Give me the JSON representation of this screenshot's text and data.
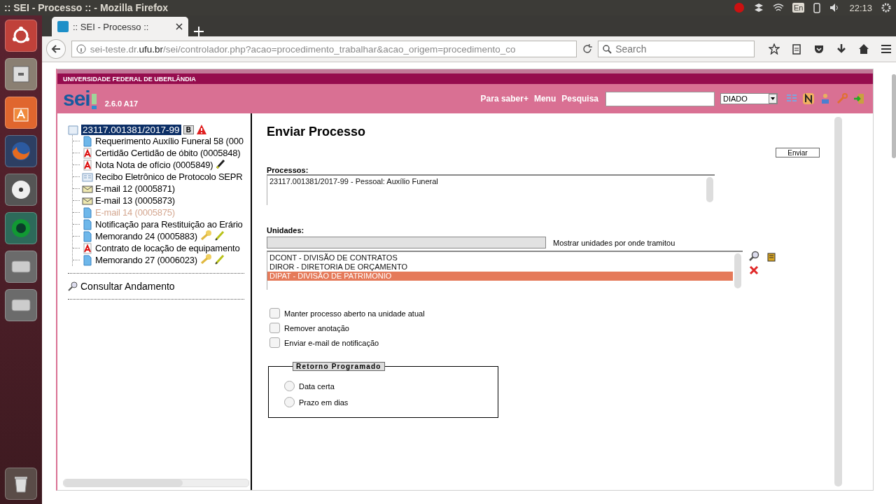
{
  "window": {
    "title": ":: SEI - Processo :: - Mozilla Firefox"
  },
  "system_tray": {
    "keyboard": "En",
    "time": "22:13"
  },
  "browser": {
    "tabs": [
      {
        "label": ":: SEI - Processo ::",
        "selected": true
      }
    ],
    "url": {
      "prefix": "sei-teste.dr.",
      "domain": "ufu.br",
      "path": "/sei/controlador.php?acao=procedimento_trabalhar&acao_origem=procedimento_co"
    },
    "search": {
      "placeholder": "Search"
    }
  },
  "sei": {
    "institution": "UNIVERSIDADE FEDERAL DE UBERLÂNDIA",
    "logo": "sei",
    "version": "2.6.0 A17",
    "links": [
      "Para saber+",
      "Menu",
      "Pesquisa"
    ],
    "unit_select": "DIADO"
  },
  "tree": {
    "label": "23117.001381/2017-99",
    "selected": true,
    "badge": "B",
    "children": [
      {
        "label": "Requerimento Auxílio Funeral 58 (000",
        "kind": "doc",
        "disabled": false,
        "key": false,
        "pen": false
      },
      {
        "label": "Certidão Certidão de óbito (0005848)",
        "kind": "pdf",
        "disabled": false,
        "key": false,
        "pen": false
      },
      {
        "label": "Nota Nota de ofício (0005849)",
        "kind": "pdf",
        "disabled": false,
        "key": false,
        "pen": true
      },
      {
        "label": "Recibo Eletrônico de Protocolo SEPR",
        "kind": "form",
        "disabled": false,
        "key": false,
        "pen": false
      },
      {
        "label": "E-mail 12 (0005871)",
        "kind": "email",
        "disabled": false,
        "key": false,
        "pen": false
      },
      {
        "label": "E-mail 13 (0005873)",
        "kind": "email",
        "disabled": false,
        "key": false,
        "pen": false
      },
      {
        "label": "E-mail 14 (0005875)",
        "kind": "doc",
        "disabled": true,
        "key": false,
        "pen": false
      },
      {
        "label": "Notificação para Restituição ao Erário",
        "kind": "doc",
        "disabled": false,
        "key": false,
        "pen": false
      },
      {
        "label": "Memorando 24 (0005883)",
        "kind": "doc",
        "disabled": false,
        "key": true,
        "pen": true
      },
      {
        "label": "Contrato de locação de equipamento",
        "kind": "pdf",
        "disabled": false,
        "key": false,
        "pen": false
      },
      {
        "label": "Memorando 27 (0006023)",
        "kind": "doc",
        "disabled": false,
        "key": true,
        "pen": true
      }
    ]
  },
  "side_links": [
    "Consultar Andamento"
  ],
  "form": {
    "title": "Enviar Processo",
    "submit": "Enviar",
    "processes_label": "Processos:",
    "processes": [
      "23117.001381/2017-99 - Pessoal: Auxílio Funeral"
    ],
    "units_label": "Unidades:",
    "show_units_label": "Mostrar unidades por onde tramitou",
    "units": [
      {
        "label": "DCONT - DIVISÃO DE CONTRATOS",
        "selected": false
      },
      {
        "label": "DIROR - DIRETORIA DE ORÇAMENTO",
        "selected": false
      },
      {
        "label": "DIPAT - DIVISÃO DE PATRIMONIO",
        "selected": true
      }
    ],
    "checkboxes": [
      {
        "label": "Manter processo aberto na unidade atual",
        "checked": false
      },
      {
        "label": "Remover anotação",
        "checked": false
      },
      {
        "label": "Enviar e-mail de notificação",
        "checked": false
      }
    ],
    "scheduled_return": {
      "legend": "Retorno Programado",
      "options": [
        {
          "label": "Data certa",
          "selected": false
        },
        {
          "label": "Prazo em dias",
          "selected": false
        }
      ]
    }
  }
}
